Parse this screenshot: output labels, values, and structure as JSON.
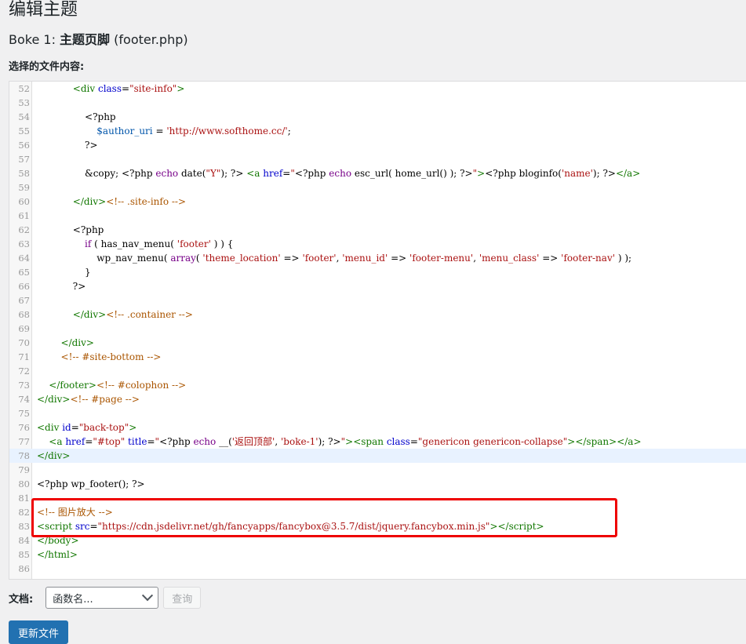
{
  "page": {
    "title": "编辑主题",
    "file_heading_prefix": "Boke 1: ",
    "file_heading_bold": "主题页脚",
    "file_heading_suffix": " (footer.php)",
    "content_label": "选择的文件内容:"
  },
  "editor": {
    "active_line": 78,
    "highlighted_lines": [
      82,
      83
    ],
    "lines": [
      {
        "n": "52",
        "html": "            <span class=\"t-tag\">&lt;div</span> <span class=\"t-attr\">class</span>=<span class=\"t-str\">\"site-info\"</span><span class=\"t-tag\">&gt;</span>"
      },
      {
        "n": "53",
        "html": ""
      },
      {
        "n": "54",
        "html": "                &lt;?php"
      },
      {
        "n": "55",
        "html": "                    <span class=\"t-var\">$author_uri</span> = <span class=\"t-str\">'http://www.softhome.cc/'</span>;"
      },
      {
        "n": "56",
        "html": "                ?&gt;"
      },
      {
        "n": "57",
        "html": ""
      },
      {
        "n": "58",
        "html": "                &amp;copy; &lt;?php <span class=\"t-kw\">echo</span> date(<span class=\"t-str\">\"Y\"</span>); ?&gt; <span class=\"t-tag\">&lt;a</span> <span class=\"t-attr\">href</span>=<span class=\"t-str\">\"</span>&lt;?php <span class=\"t-kw\">echo</span> esc_url( home_url() ); ?&gt;<span class=\"t-str\">\"</span><span class=\"t-tag\">&gt;</span>&lt;?php bloginfo(<span class=\"t-str\">'name'</span>); ?&gt;<span class=\"t-tag\">&lt;/a&gt;</span>"
      },
      {
        "n": "59",
        "html": ""
      },
      {
        "n": "60",
        "html": "            <span class=\"t-tag\">&lt;/div&gt;</span><span class=\"t-cmt\">&lt;!-- .site-info --&gt;</span>"
      },
      {
        "n": "61",
        "html": ""
      },
      {
        "n": "62",
        "html": "            &lt;?php"
      },
      {
        "n": "63",
        "html": "                <span class=\"t-kw\">if</span> ( has_nav_menu( <span class=\"t-str\">'footer'</span> ) ) {"
      },
      {
        "n": "64",
        "html": "                    wp_nav_menu( <span class=\"t-kw\">array</span>( <span class=\"t-str\">'theme_location'</span> =&gt; <span class=\"t-str\">'footer'</span>, <span class=\"t-str\">'menu_id'</span> =&gt; <span class=\"t-str\">'footer-menu'</span>, <span class=\"t-str\">'menu_class'</span> =&gt; <span class=\"t-str\">'footer-nav'</span> ) );"
      },
      {
        "n": "65",
        "html": "                }"
      },
      {
        "n": "66",
        "html": "            ?&gt;"
      },
      {
        "n": "67",
        "html": ""
      },
      {
        "n": "68",
        "html": "            <span class=\"t-tag\">&lt;/div&gt;</span><span class=\"t-cmt\">&lt;!-- .container --&gt;</span>"
      },
      {
        "n": "69",
        "html": ""
      },
      {
        "n": "70",
        "html": "        <span class=\"t-tag\">&lt;/div&gt;</span>"
      },
      {
        "n": "71",
        "html": "        <span class=\"t-cmt\">&lt;!-- #site-bottom --&gt;</span>"
      },
      {
        "n": "72",
        "html": ""
      },
      {
        "n": "73",
        "html": "    <span class=\"t-tag\">&lt;/footer&gt;</span><span class=\"t-cmt\">&lt;!-- #colophon --&gt;</span>"
      },
      {
        "n": "74",
        "html": "<span class=\"t-tag\">&lt;/div&gt;</span><span class=\"t-cmt\">&lt;!-- #page --&gt;</span>"
      },
      {
        "n": "75",
        "html": ""
      },
      {
        "n": "76",
        "html": "<span class=\"t-tag\">&lt;div</span> <span class=\"t-attr\">id</span>=<span class=\"t-str\">\"back-top\"</span><span class=\"t-tag\">&gt;</span>"
      },
      {
        "n": "77",
        "html": "    <span class=\"t-tag\">&lt;a</span> <span class=\"t-attr\">href</span>=<span class=\"t-str\">\"#top\"</span> <span class=\"t-attr\">title</span>=<span class=\"t-str\">\"</span>&lt;?php <span class=\"t-kw\">echo</span> __(<span class=\"t-str\">'返回顶部'</span>, <span class=\"t-str\">'boke-1'</span>); ?&gt;<span class=\"t-str\">\"</span><span class=\"t-tag\">&gt;&lt;span</span> <span class=\"t-attr\">class</span>=<span class=\"t-str\">\"genericon genericon-collapse\"</span><span class=\"t-tag\">&gt;&lt;/span&gt;&lt;/a&gt;</span>"
      },
      {
        "n": "78",
        "html": "<span class=\"t-tag\">&lt;/div&gt;</span>"
      },
      {
        "n": "79",
        "html": ""
      },
      {
        "n": "80",
        "html": "&lt;?php wp_footer(); ?&gt;"
      },
      {
        "n": "81",
        "html": ""
      },
      {
        "n": "82",
        "html": "<span class=\"t-cmt\">&lt;!-- 图片放大 --&gt;</span>"
      },
      {
        "n": "83",
        "html": "<span class=\"t-tag\">&lt;script</span> <span class=\"t-attr\">src</span>=<span class=\"t-str\">\"https://cdn.jsdelivr.net/gh/fancyapps/fancybox@3.5.7/dist/jquery.fancybox.min.js\"</span><span class=\"t-tag\">&gt;&lt;/script&gt;</span>"
      },
      {
        "n": "84",
        "html": "<span class=\"t-tag\">&lt;/body&gt;</span>"
      },
      {
        "n": "85",
        "html": "<span class=\"t-tag\">&lt;/html&gt;</span>"
      },
      {
        "n": "86",
        "html": ""
      }
    ]
  },
  "documentation": {
    "label": "文档:",
    "select_value": "函数名...",
    "lookup_button": "查询"
  },
  "actions": {
    "update_button": "更新文件"
  },
  "colors": {
    "primary": "#2271b1",
    "highlight_border": "#e00000"
  }
}
